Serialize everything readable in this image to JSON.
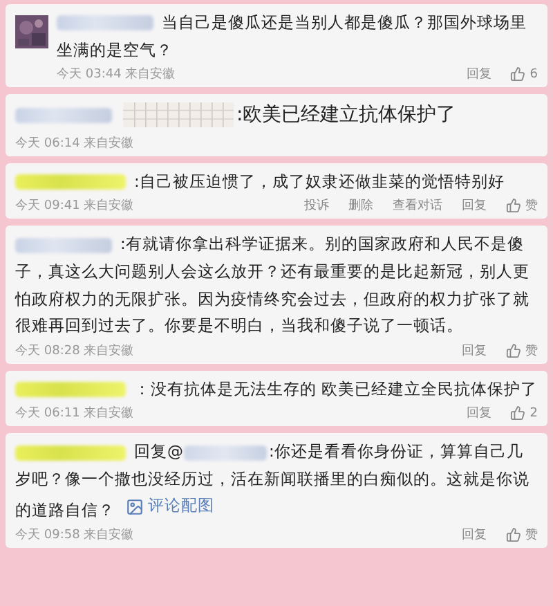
{
  "comments": [
    {
      "avatar": true,
      "name_highlight": false,
      "large": false,
      "quoted_image": false,
      "text": "当自己是傻瓜还是当别人都是傻瓜？那国外球场里坐满的是空气？",
      "time": "今天 03:44 来自安徽",
      "actions": [
        "回复"
      ],
      "like": "6"
    },
    {
      "avatar": false,
      "name_highlight": false,
      "large": true,
      "quoted_image": true,
      "text": ":欧美已经建立抗体保护了",
      "time": "今天 06:14 来自安徽"
    },
    {
      "avatar": false,
      "name_highlight": true,
      "large": false,
      "quoted_image": false,
      "text": ":自己被压迫惯了，成了奴隶还做韭菜的觉悟特别好",
      "time": "今天 09:41 来自安徽",
      "actions": [
        "投诉",
        "删除",
        "查看对话",
        "回复"
      ],
      "like": "赞"
    },
    {
      "avatar": false,
      "name_highlight": false,
      "large": false,
      "quoted_image": false,
      "text": ":有就请你拿出科学证据来。别的国家政府和人民不是傻子，真这么大问题别人会这么放开？还有最重要的是比起新冠，别人更怕政府权力的无限扩张。因为疫情终究会过去，但政府的权力扩张了就很难再回到过去了。你要是不明白，当我和傻子说了一顿话。",
      "time": "今天 08:28 来自安徽",
      "actions": [
        "回复"
      ],
      "like": "赞"
    },
    {
      "avatar": false,
      "name_highlight": true,
      "large": false,
      "quoted_image": false,
      "text": "：没有抗体是无法生存的 欧美已经建立全民抗体保护了",
      "time": "今天 06:11 来自安徽",
      "actions": [
        "回复"
      ],
      "like": "2"
    },
    {
      "avatar": false,
      "name_highlight": true,
      "large": false,
      "quoted_image": false,
      "reply_prefix": "回复@",
      "text": ":你还是看看你身份证，算算自己几岁吧？像一个撒也没经历过，活在新闻联播里的白痴似的。这就是你说的道路自信？",
      "attachment": "评论配图",
      "time": "今天 09:58 来自安徽",
      "actions": [
        "回复"
      ],
      "like": "赞"
    }
  ]
}
